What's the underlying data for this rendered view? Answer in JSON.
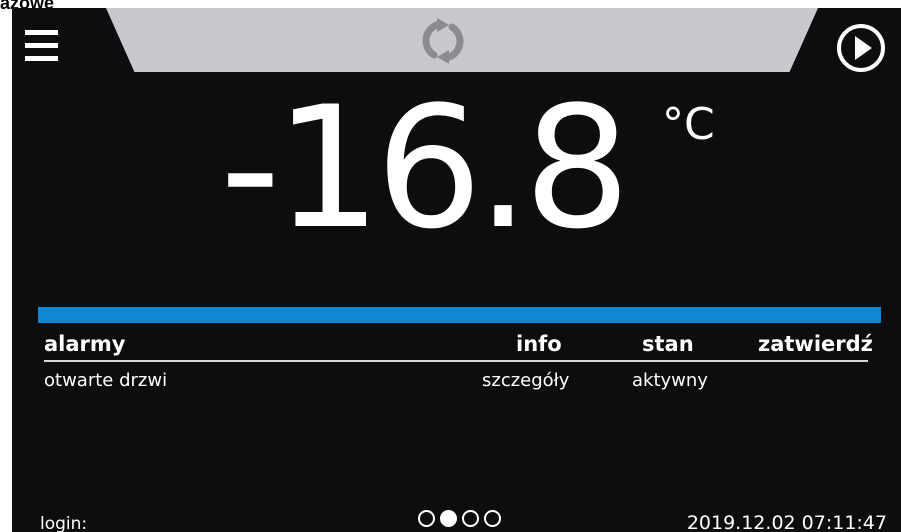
{
  "caption": "azowe",
  "header": {
    "menu_icon": "hamburger-menu-icon",
    "center_icon": "sync-icon",
    "right_icon": "play-icon"
  },
  "temperature": {
    "value": "-16.8",
    "unit": "°C"
  },
  "alarm_table": {
    "headers": {
      "name": "alarmy",
      "info": "info",
      "state": "stan",
      "confirm": "zatwierdź"
    },
    "rows": [
      {
        "name": "otwarte drzwi",
        "info": "szczegóły",
        "state": "aktywny",
        "confirm": ""
      }
    ]
  },
  "footer": {
    "login": "login:",
    "pages": {
      "total": 4,
      "current": 2
    },
    "datetime": "2019.12.02 07:11:47"
  },
  "colors": {
    "background": "#0d0d0f",
    "top_tab": "#c8c9ce",
    "accent_bar": "#0d89d3",
    "text": "#ffffff"
  }
}
